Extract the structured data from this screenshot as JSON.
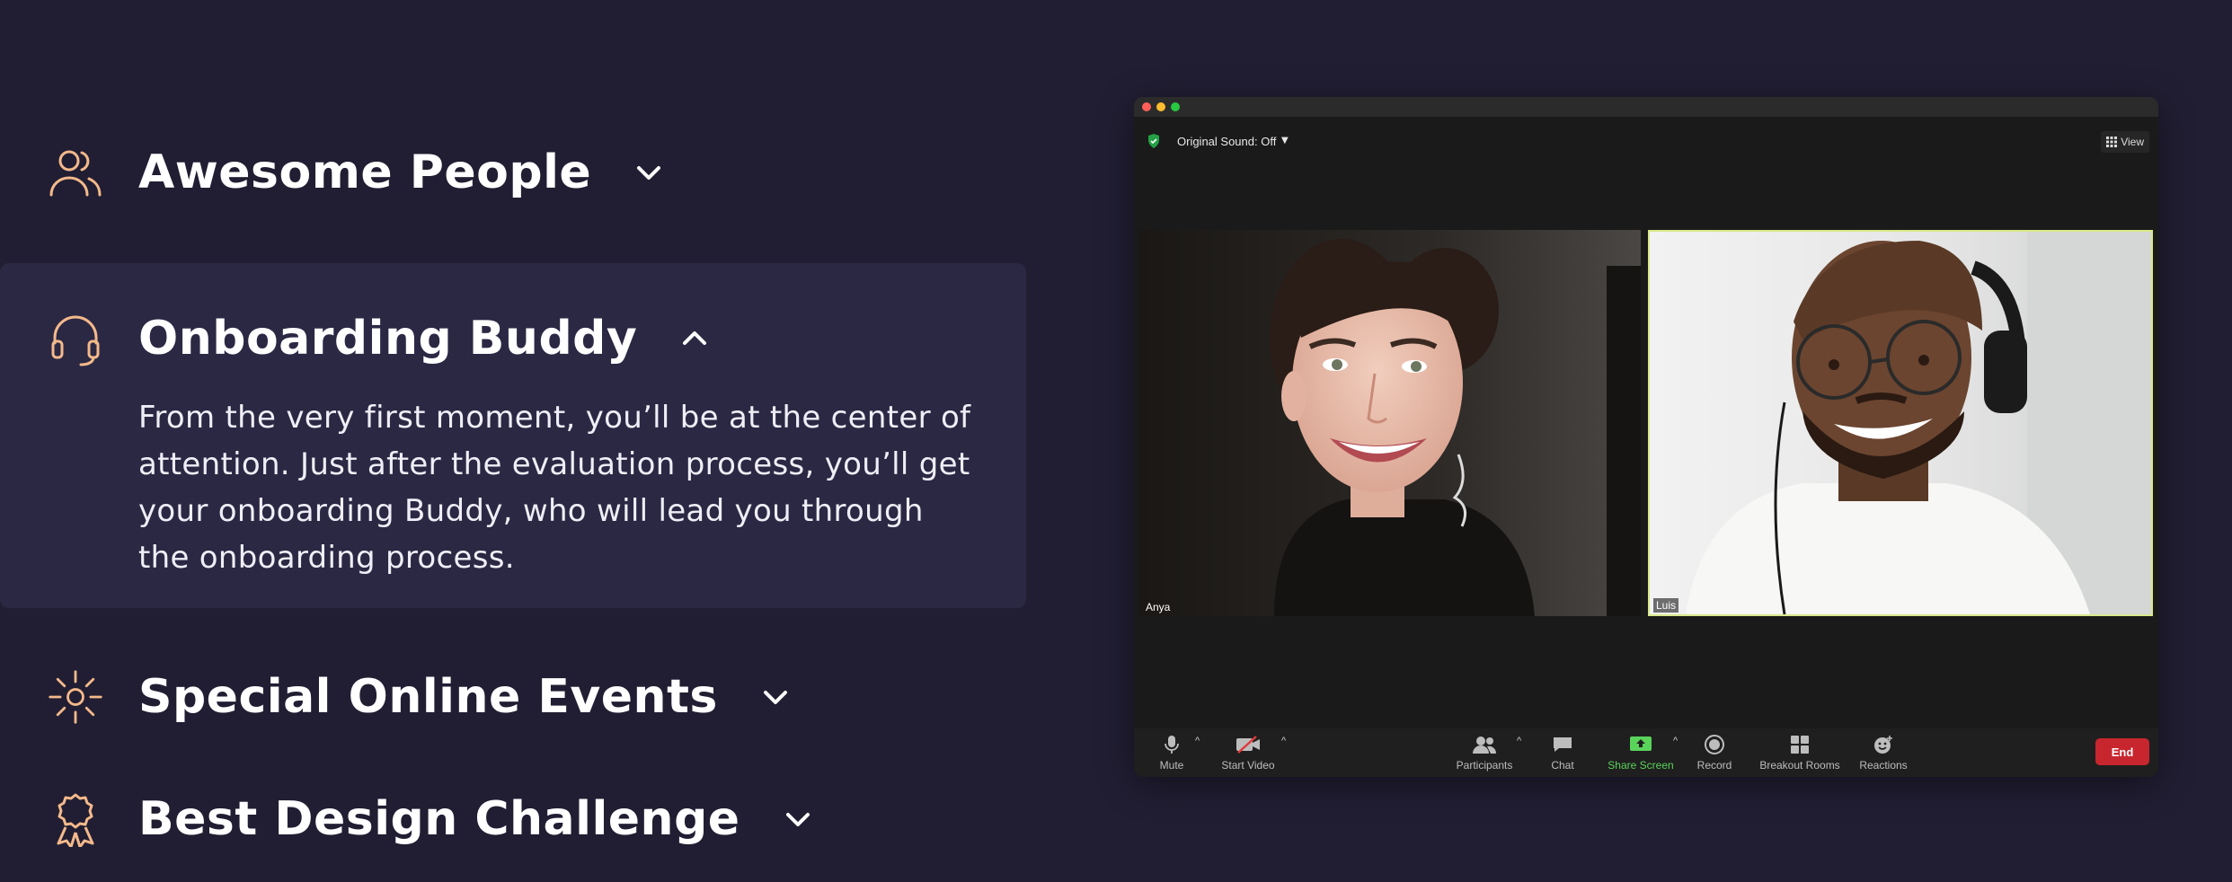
{
  "colors": {
    "page_bg": "#211e33",
    "panel_bg": "#2b2844",
    "icon_accent": "#f4b98b",
    "zoom_end": "#c8262e",
    "zoom_share": "#5ad35a",
    "active_speaker": "#d8e98a"
  },
  "accordion": {
    "items": [
      {
        "title": "Awesome People",
        "icon": "people-icon",
        "expanded": false
      },
      {
        "title": "Onboarding Buddy",
        "icon": "headset-icon",
        "expanded": true,
        "body": "From the very first moment, you’ll be at the center of attention. Just after the evaluation process, you’ll get your onboarding Buddy, who will lead you through the onboarding process."
      },
      {
        "title": "Special Online Events",
        "icon": "sun-icon",
        "expanded": false
      },
      {
        "title": "Best Design Challenge",
        "icon": "award-icon",
        "expanded": false
      }
    ]
  },
  "zoom": {
    "original_sound": "Original Sound: Off",
    "view_label": "View",
    "participants": [
      {
        "name": "Anya"
      },
      {
        "name": "Luis",
        "active_speaker": true
      }
    ],
    "toolbar": {
      "mute": "Mute",
      "start_video": "Start Video",
      "participants": "Participants",
      "chat": "Chat",
      "share_screen": "Share Screen",
      "record": "Record",
      "breakout_rooms": "Breakout Rooms",
      "reactions": "Reactions",
      "end": "End"
    }
  }
}
